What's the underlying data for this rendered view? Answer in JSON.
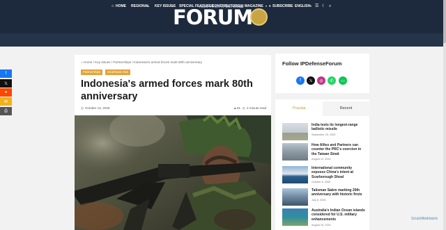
{
  "header": {
    "logo_tagline": "INDO-PACIFIC DEFENSE",
    "logo_text": "FORUM"
  },
  "nav": {
    "items": [
      "HOME",
      "REGIONAL",
      "KEY ISSUES",
      "SPECIAL FEATURES",
      "CONTRIBUTORS",
      "MAGAZINE",
      "SUBSCRIBE",
      "ENGLISH"
    ]
  },
  "share_bar": {
    "buttons": [
      {
        "icon": "facebook-icon",
        "glyph": "f",
        "color": "#1877f2"
      },
      {
        "icon": "x-icon",
        "glyph": "𝕏",
        "color": "#111111"
      },
      {
        "icon": "reddit-icon",
        "glyph": "●",
        "color": "#ff4500"
      },
      {
        "icon": "email-icon",
        "glyph": "✉",
        "color": "#f0b21a"
      },
      {
        "icon": "print-icon",
        "glyph": "⎙",
        "color": "#555555"
      }
    ]
  },
  "article": {
    "breadcrumb": "⌂ Home / Key Issues / Partnerships / Indonesia's armed forces mark 80th anniversary",
    "tags": [
      "Partnerships",
      "Southeast Asia"
    ],
    "title": "Indonesia's armed forces mark 80th anniversary",
    "date": "October 13, 2025",
    "views": "81",
    "read_time": "2 minute read"
  },
  "sidebar": {
    "follow_title": "Follow IPDefenseForum",
    "social": [
      {
        "icon": "facebook-icon",
        "glyph": "f",
        "color": "#1877f2"
      },
      {
        "icon": "x-icon",
        "glyph": "𝕏",
        "color": "#111111"
      },
      {
        "icon": "instagram-icon",
        "glyph": "◎",
        "color": "#c13584"
      },
      {
        "icon": "whatsapp-icon",
        "glyph": "✆",
        "color": "#25d366"
      },
      {
        "icon": "line-icon",
        "glyph": "▭",
        "color": "#06c755"
      }
    ],
    "tabs": [
      "Popular",
      "Recent"
    ],
    "active_tab": "Popular",
    "posts": [
      {
        "title": "India tests its longest-range ballistic missile",
        "date": "September 29, 2025"
      },
      {
        "title": "How Allies and Partners can counter the PRC's coercion in the Taiwan Strait",
        "date": "August 12, 2024"
      },
      {
        "title": "International community exposes China's intent at Scarborough Shoal",
        "date": "October 8, 2025"
      },
      {
        "title": "Talisman Sabre marking 20th anniversary with historic firsts",
        "date": "July 8, 2025"
      },
      {
        "title": "Australia's Indian Ocean islands considered for U.S. military enhancements",
        "date": "August 15, 2024"
      }
    ]
  },
  "watermark": "ScanMalware",
  "colors": {
    "header_bg": "#1d2a3d",
    "nav_bg": "#26344a",
    "tag_bg": "#e3a33a",
    "accent": "#d39a3a"
  }
}
